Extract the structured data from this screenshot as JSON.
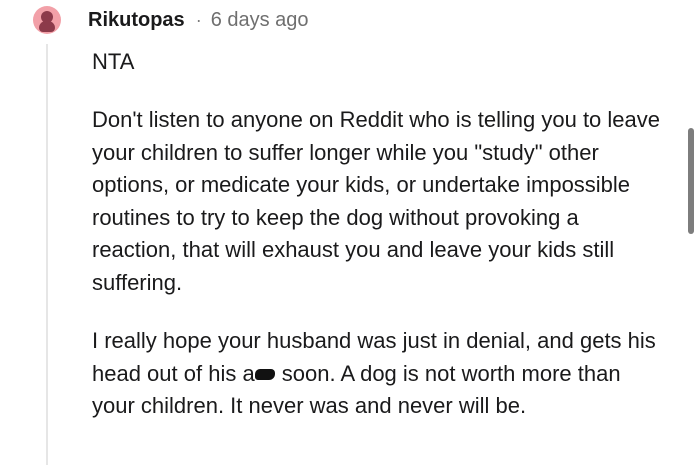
{
  "comment": {
    "username": "Rikutopas",
    "separator": "·",
    "timestamp": "6 days ago",
    "verdict": "NTA",
    "paragraph1": "Don't listen to anyone on Reddit who is telling you to leave your children to suffer longer while you \"study\" other options, or medicate your kids, or undertake impossible routines to try to keep the dog without provoking a reaction, that will exhaust you and leave your kids still suffering.",
    "paragraph2_before": "I really hope your husband was just in denial, and gets his head out of his a",
    "paragraph2_after": " soon. A dog is not worth more than your children. It never was and never will be."
  },
  "avatar_icon": "user-avatar-icon",
  "colors": {
    "avatar_bg": "#f2a0a8",
    "avatar_figure": "#8c3a4a",
    "text": "#1a1a1b",
    "meta_text": "#6f6f6f",
    "thread_line": "#e6e6e6"
  }
}
